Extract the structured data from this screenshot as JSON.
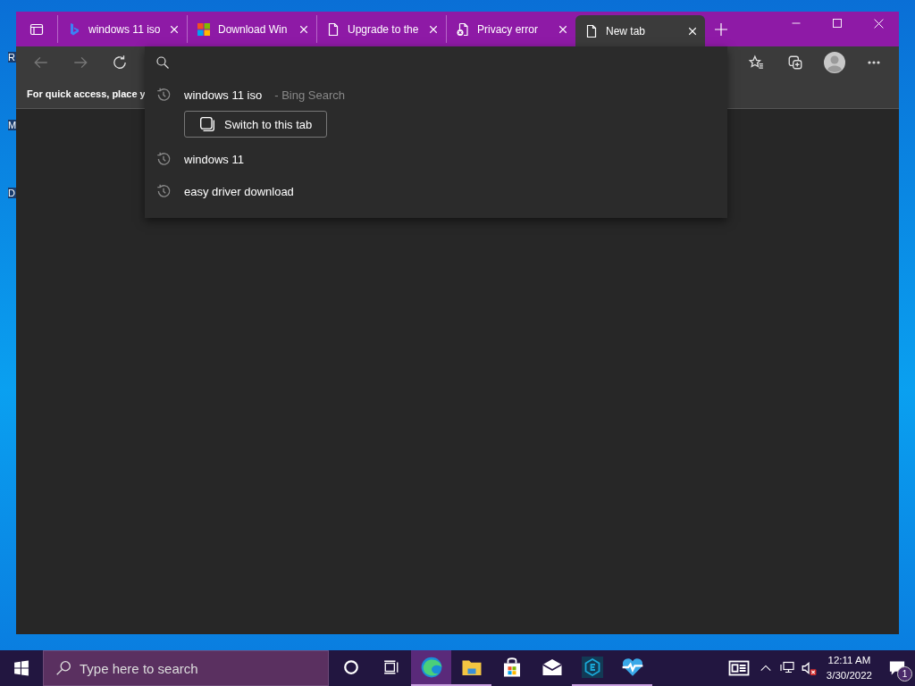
{
  "desktop": {
    "icon_labels": [
      "R",
      "M",
      "D"
    ]
  },
  "browser": {
    "tabs": [
      {
        "title": "windows 11 iso",
        "kind": "bing",
        "selected": false
      },
      {
        "title": "Download Win",
        "kind": "microsoft",
        "selected": false
      },
      {
        "title": "Upgrade to the",
        "kind": "page",
        "selected": false
      },
      {
        "title": "Privacy error",
        "kind": "page-error",
        "selected": false
      },
      {
        "title": "New tab",
        "kind": "page",
        "selected": true
      }
    ],
    "favorites_bar": {
      "text": "For quick access, place y"
    },
    "suggestions": [
      {
        "text": "windows 11 iso",
        "suffix": "- Bing Search",
        "action": "Switch to this tab"
      },
      {
        "text": "windows 11"
      },
      {
        "text": "easy driver download"
      }
    ]
  },
  "taskbar": {
    "search": {
      "placeholder": "Type here to search"
    },
    "apps": [
      {
        "kind": "cortana",
        "running": false,
        "selected": false
      },
      {
        "kind": "task-view",
        "running": false,
        "selected": false
      },
      {
        "kind": "edge",
        "running": true,
        "selected": true
      },
      {
        "kind": "explorer",
        "running": true,
        "selected": false
      },
      {
        "kind": "store",
        "running": false,
        "selected": false
      },
      {
        "kind": "mail",
        "running": false,
        "selected": false
      },
      {
        "kind": "shield",
        "running": true,
        "selected": false
      },
      {
        "kind": "health",
        "running": true,
        "selected": false
      }
    ],
    "time": "12:11 AM",
    "date": "3/30/2022",
    "notification_count": "1"
  }
}
